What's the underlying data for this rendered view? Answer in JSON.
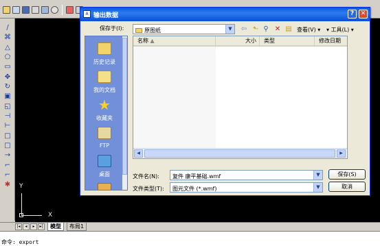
{
  "cad": {
    "ucs_y_label": "Y",
    "ucs_x_label": "X",
    "tabs": [
      "模型",
      "布局1"
    ],
    "command": "命令: export"
  },
  "dialog": {
    "title": "输出数据",
    "save_in_label": "保存于(I):",
    "save_in_value": "原图纸",
    "view_menu": "查看(V)",
    "tools_menu": "工具(L)",
    "places": [
      {
        "label": "历史记录",
        "icon": "history-icon"
      },
      {
        "label": "我的文档",
        "icon": "my-documents-icon"
      },
      {
        "label": "收藏夹",
        "icon": "favorites-icon"
      },
      {
        "label": "FTP",
        "icon": "ftp-icon"
      },
      {
        "label": "桌面",
        "icon": "desktop-icon"
      }
    ],
    "columns": [
      "名称",
      "大小",
      "类型",
      "修改日期"
    ],
    "file_name_label": "文件名(N):",
    "file_name_value": "复件 康平基础.wmf",
    "file_type_label": "文件类型(T):",
    "file_type_value": "图元文件 (*.wmf)",
    "save_button": "保存(S)",
    "cancel_button": "取消"
  },
  "colors": {
    "titlebar": "#0a58e0",
    "places_bg": "#7290d9",
    "canvas": "#000000",
    "dialog_bg": "#ece9d8"
  }
}
